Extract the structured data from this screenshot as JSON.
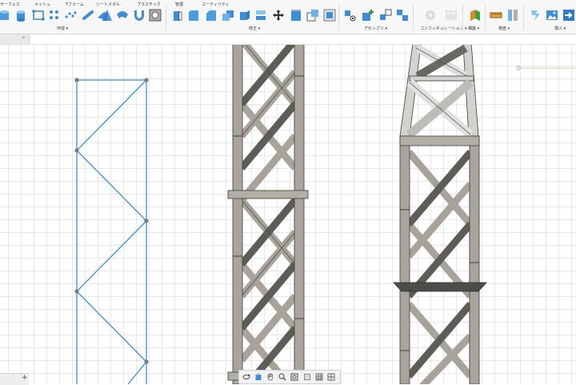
{
  "toolbar": {
    "tabs": [
      "サーフェス",
      "メッシュ",
      "Tフォーム",
      "シートメタル",
      "プラスチック",
      "管理",
      "ユーティリティ"
    ],
    "groups": [
      "作成 ▾",
      "修正 ▾",
      "アセンブリ ▾",
      "コンフィギュレーション ▾",
      "構築 ▾",
      "検査 ▾",
      "挿入 ▾"
    ]
  },
  "panel": {
    "collapse_label": "–"
  },
  "bottom": {
    "add_label": "+"
  },
  "icons": {
    "create": [
      "box-icon",
      "cylinder-icon",
      "sketch-rect-icon",
      "pattern-icon",
      "pipe-icon",
      "cone-icon",
      "loft-icon",
      "shield-icon",
      "hole-icon"
    ],
    "modify": [
      "press-pull-icon",
      "fillet-icon",
      "chamfer-icon",
      "shell-icon",
      "draft-icon",
      "move-icon",
      "align-icon",
      "combine-icon",
      "scale-icon"
    ],
    "assemble": [
      "joint-icon",
      "new-component-icon",
      "as-built-joint-icon",
      "rigid-group-icon"
    ],
    "configure": [
      "configure-disabled-icon",
      "configure-table-disabled-icon"
    ],
    "construct": [
      "plane-icon"
    ],
    "inspect": [
      "measure-icon",
      "interference-icon"
    ],
    "insert": [
      "insert-mesh-icon",
      "insert-image-icon",
      "insert-svg-icon"
    ],
    "nav": [
      "orbit-icon",
      "pan-icon",
      "hand-icon",
      "zoom-icon",
      "fit-icon",
      "display-style-icon",
      "grid-icon",
      "viewports-icon"
    ]
  },
  "colors": {
    "sketch_line": "#3a8fd6",
    "sketch_point": "#7a7a7a",
    "steel_face": "#a7a39a",
    "steel_dark": "#5a5853",
    "steel_light": "#d2d2ce",
    "grid": "#e7e7e7"
  }
}
